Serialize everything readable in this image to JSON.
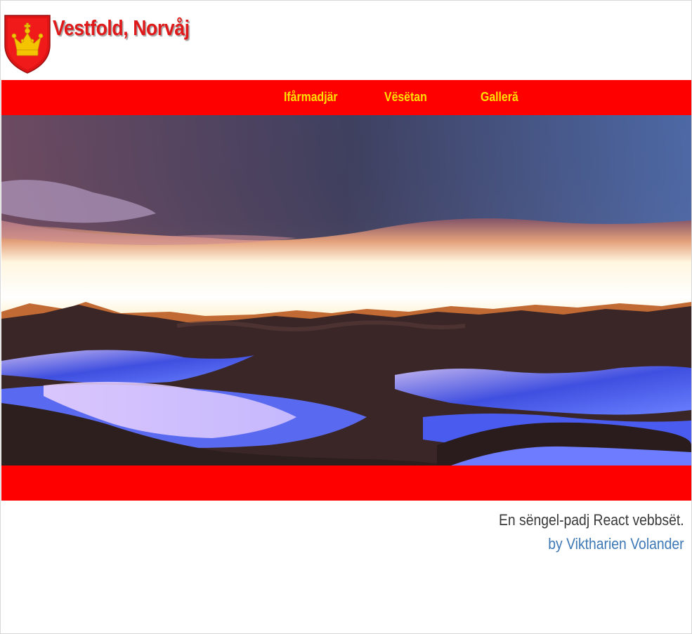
{
  "header": {
    "title": "Vestfold, Norvåj",
    "logo_icon": "coat-of-arms-crown-icon"
  },
  "nav": {
    "items": [
      {
        "label": "Ifårmadjär"
      },
      {
        "label": "Vësëtan"
      },
      {
        "label": "Galleră"
      }
    ]
  },
  "hero": {
    "image": "mountain-sunset-snow-landscape"
  },
  "footer": {
    "tagline": "En sëngel-padj React vebbsët.",
    "author": "by Viktharien Volander"
  },
  "colors": {
    "brand_red": "#ff0000",
    "nav_text": "#ffe000",
    "title_red": "#e01a1a",
    "link_blue": "#3d78b5"
  }
}
